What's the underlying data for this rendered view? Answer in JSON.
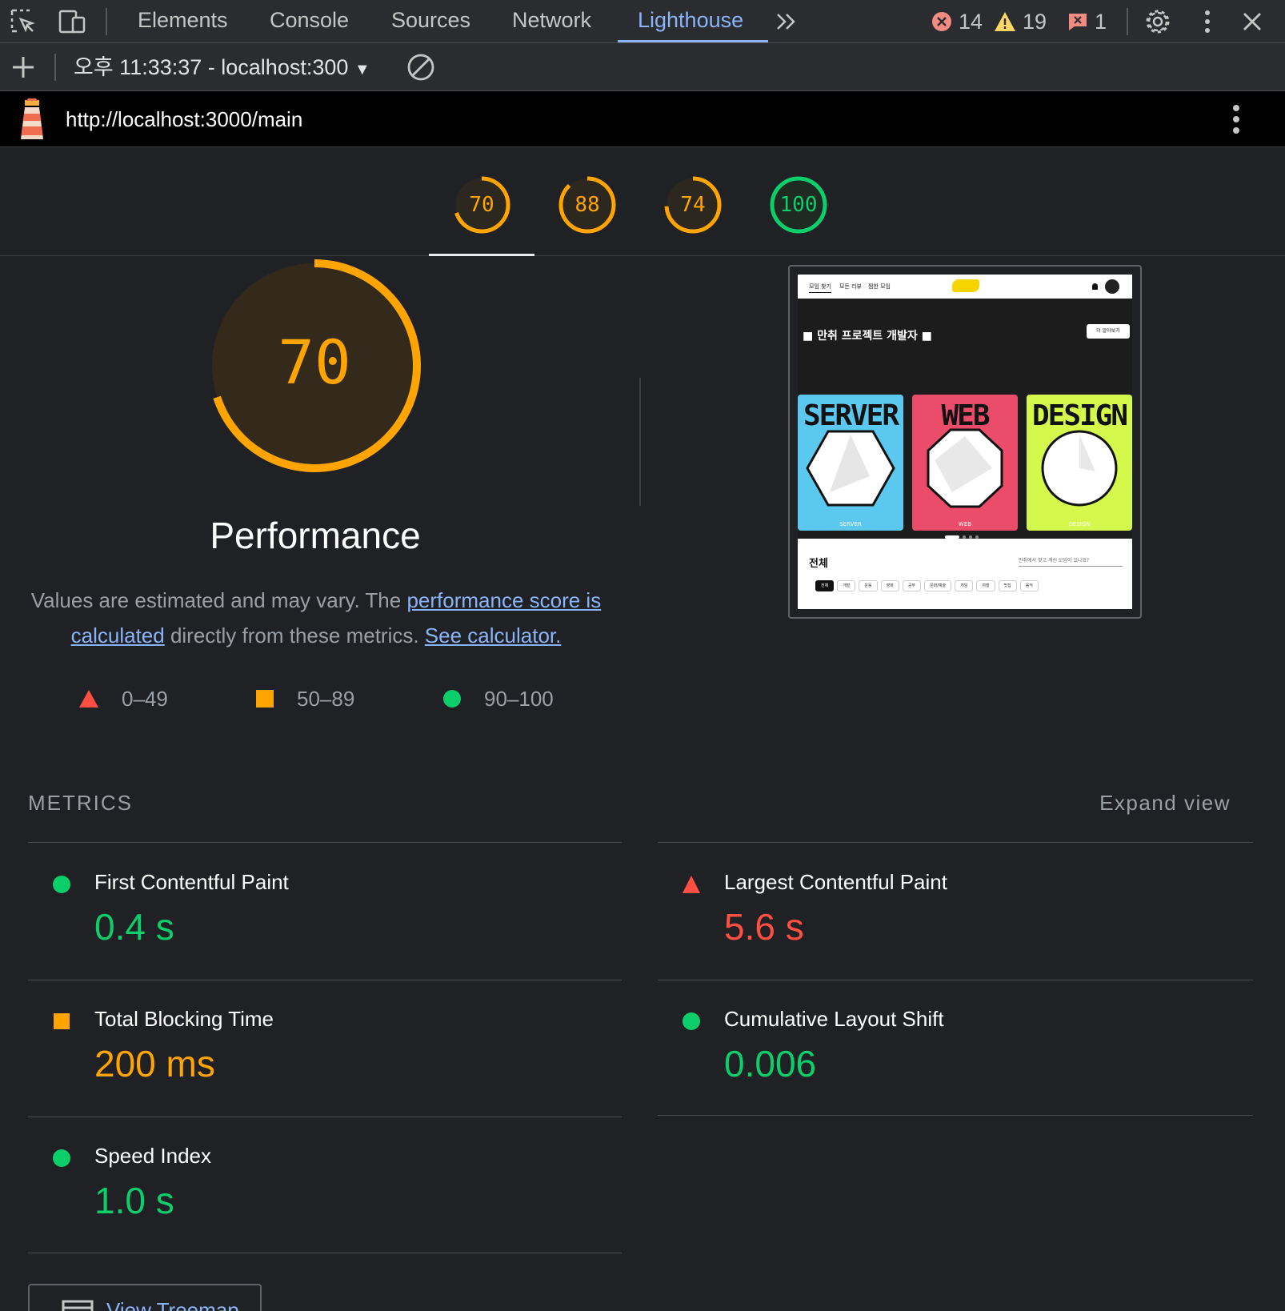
{
  "devtools": {
    "tabs": [
      "Elements",
      "Console",
      "Sources",
      "Network",
      "Lighthouse"
    ],
    "active_tab": "Lighthouse",
    "errors": "14",
    "warnings": "19",
    "issues": "1"
  },
  "toolbar": {
    "report_selector": "오후 11:33:37 - localhost:300"
  },
  "url_bar": {
    "url": "http://localhost:3000/main"
  },
  "categories": [
    {
      "score": "70",
      "status": "average"
    },
    {
      "score": "88",
      "status": "average"
    },
    {
      "score": "74",
      "status": "average"
    },
    {
      "score": "100",
      "status": "pass"
    }
  ],
  "performance": {
    "score": "70",
    "score_fraction": 0.7,
    "title": "Performance",
    "desc_prefix": "Values are estimated and may vary. The ",
    "desc_link1": "performance score is calculated",
    "desc_middle": " directly from these metrics. ",
    "desc_link2": "See calculator."
  },
  "legend": [
    {
      "range": "0–49",
      "shape": "triangle",
      "color": "#ff4e42"
    },
    {
      "range": "50–89",
      "shape": "square",
      "color": "#ffa400"
    },
    {
      "range": "90–100",
      "shape": "circle",
      "color": "#0cce6b"
    }
  ],
  "screenshot": {
    "nav": [
      "모임 찾기",
      "모든 리뷰",
      "찜한 모임"
    ],
    "heading": "■ 만취 프로젝트 개발자 ■",
    "more_button": "더 알아보기",
    "cards": [
      {
        "title": "SERVER",
        "foot": "SERVER",
        "color": "#5bc8ef"
      },
      {
        "title": "WEB",
        "foot": "WEB",
        "color": "#ea4c6a"
      },
      {
        "title": "DESIGN",
        "foot": "DESIGN",
        "color": "#d4f94c"
      }
    ],
    "section": "전체",
    "search_placeholder": "만취에서 찾고 계신 모임이 있나요?",
    "chips": [
      "전체",
      "개발",
      "운동",
      "영화",
      "공부",
      "문화/예술",
      "게임",
      "여행",
      "맛집",
      "음악"
    ]
  },
  "metrics": {
    "title": "METRICS",
    "expand": "Expand view",
    "items": [
      {
        "label": "First Contentful Paint",
        "value": "0.4 s",
        "status": "pass"
      },
      {
        "label": "Largest Contentful Paint",
        "value": "5.6 s",
        "status": "fail"
      },
      {
        "label": "Total Blocking Time",
        "value": "200 ms",
        "status": "average"
      },
      {
        "label": "Cumulative Layout Shift",
        "value": "0.006",
        "status": "pass"
      },
      {
        "label": "Speed Index",
        "value": "1.0 s",
        "status": "pass"
      }
    ]
  },
  "treemap_button": "View Treemap",
  "colors": {
    "pass": "#0cce6b",
    "average": "#ffa400",
    "fail": "#ff4e42",
    "link": "#8ab4f8"
  }
}
